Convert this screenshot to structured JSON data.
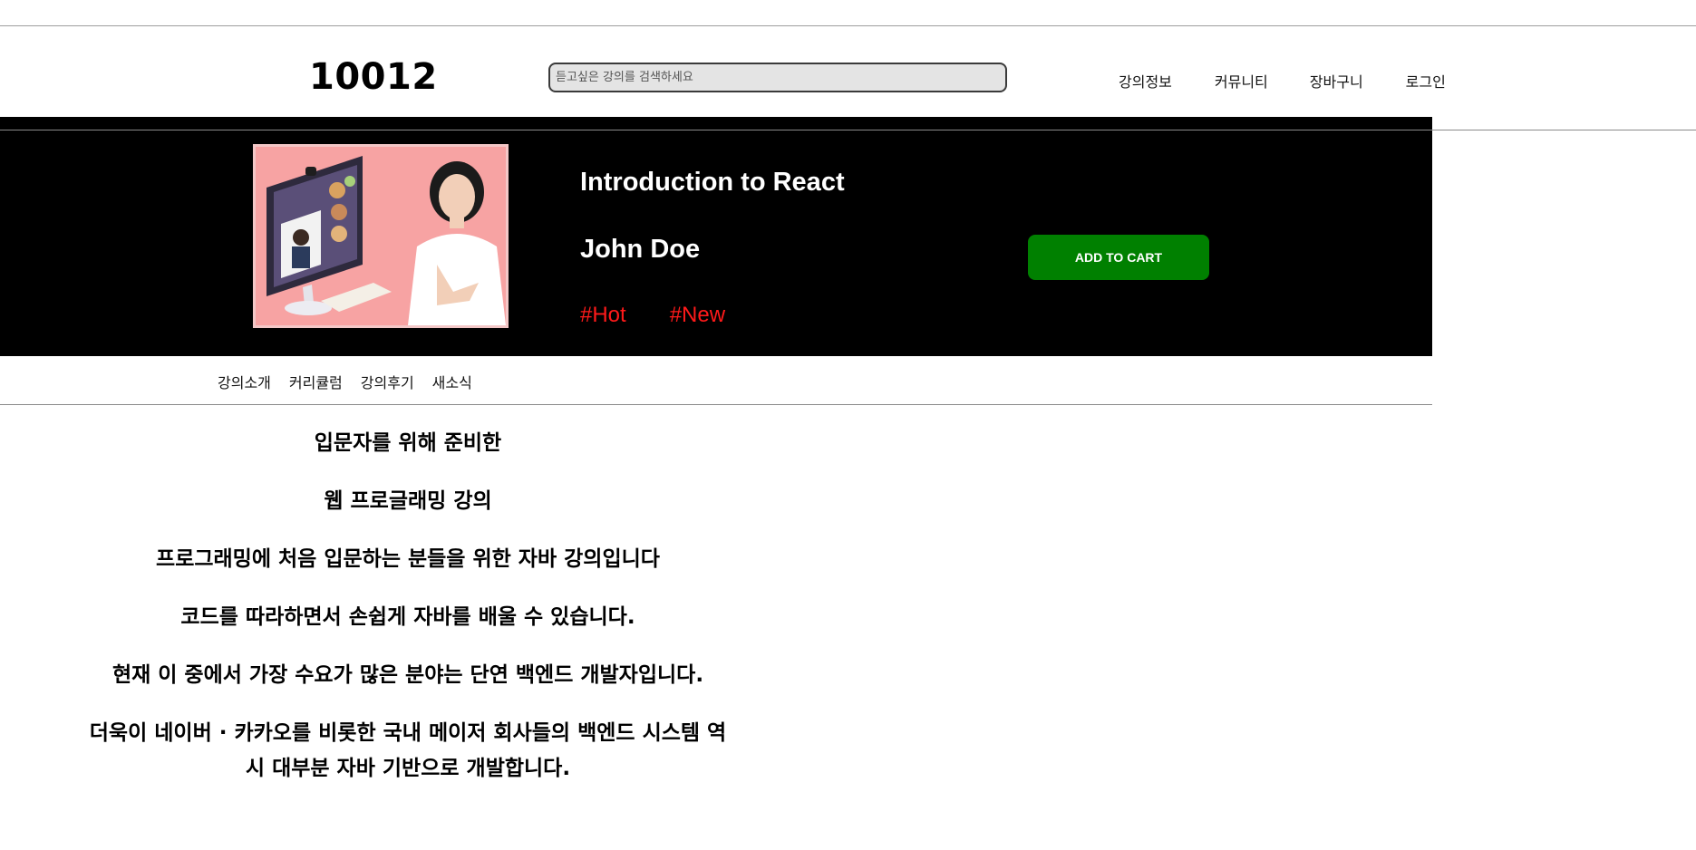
{
  "header": {
    "logo": "10012",
    "search_placeholder": "듣고싶은 강의를 검색하세요",
    "nav": [
      "강의정보",
      "커뮤니티",
      "장바구니",
      "로그인"
    ]
  },
  "hero": {
    "course_title": "Introduction to React",
    "instructor": "John Doe",
    "tags": [
      "#Hot",
      "#New"
    ],
    "add_to_cart_label": "ADD TO CART",
    "colors": {
      "background": "#000000",
      "tag": "#ff1a1a",
      "button": "#008000"
    }
  },
  "subnav": [
    "강의소개",
    "커리큘럼",
    "강의후기",
    "새소식"
  ],
  "content": {
    "paragraphs": [
      "입문자를 위해 준비한",
      "웹 프로글래밍 강의",
      "프로그래밍에 처음 입문하는 분들을 위한 자바 강의입니다",
      "코드를 따라하면서 손쉽게 자바를 배울 수 있습니다.",
      "현재 이 중에서 가장 수요가 많은 분야는 단연 백엔드 개발자입니다.",
      "더욱이 네이버 · 카카오를 비롯한 국내 메이저 회사들의 백엔드 시스템 역시 대부분 자바 기반으로 개발합니다."
    ]
  }
}
